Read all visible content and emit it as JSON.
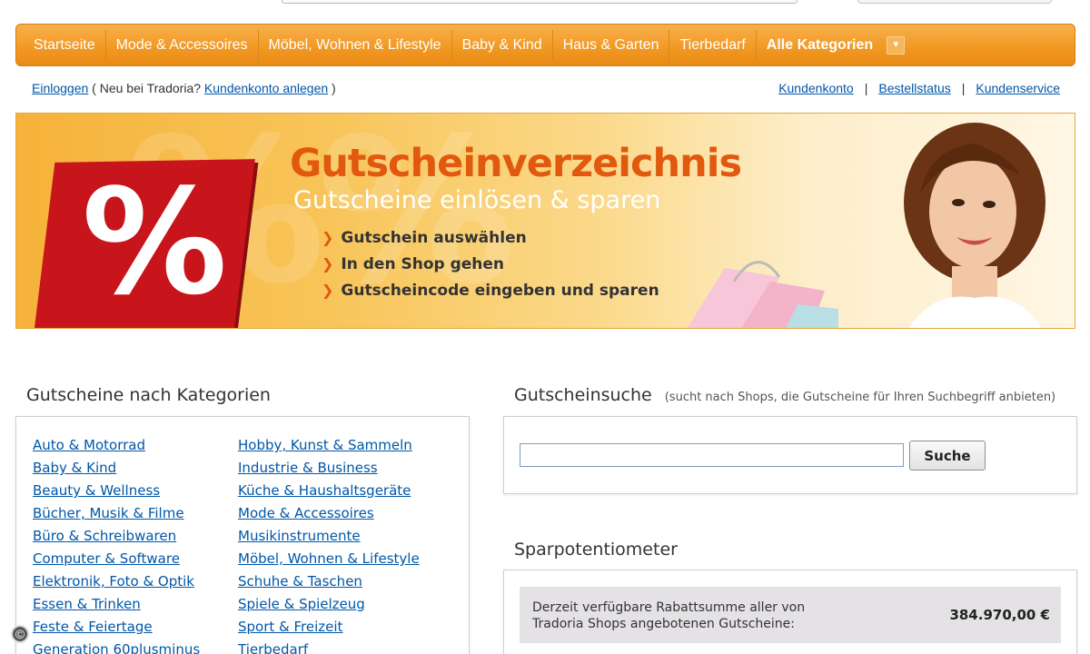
{
  "nav": {
    "items": [
      "Startseite",
      "Mode & Accessoires",
      "Möbel, Wohnen & Lifestyle",
      "Baby & Kind",
      "Haus & Garten",
      "Tierbedarf"
    ],
    "all": "Alle Kategorien"
  },
  "account": {
    "login": "Einloggen",
    "new_prefix": "( Neu bei Tradoria?",
    "create": "Kundenkonto anlegen",
    "close_paren": ")",
    "kundenkonto": "Kundenkonto",
    "bestellstatus": "Bestellstatus",
    "kundenservice": "Kundenservice",
    "sep": "|"
  },
  "banner": {
    "title": "Gutscheinverzeichnis",
    "subtitle": "Gutscheine einlösen & sparen",
    "steps": [
      "Gutschein auswählen",
      "In den Shop gehen",
      "Gutscheincode eingeben und sparen"
    ],
    "percent": "%"
  },
  "categories": {
    "title": "Gutscheine nach Kategorien",
    "col1": [
      "Auto & Motorrad",
      "Baby & Kind",
      "Beauty & Wellness",
      "Bücher, Musik & Filme",
      "Büro & Schreibwaren",
      "Computer & Software",
      "Elektronik, Foto & Optik",
      "Essen & Trinken",
      "Feste & Feiertage",
      "Generation 60plusminus"
    ],
    "col2": [
      "Hobby, Kunst & Sammeln",
      "Industrie & Business",
      "Küche & Haushaltsgeräte",
      "Mode & Accessoires",
      "Musikinstrumente",
      "Möbel, Wohnen & Lifestyle",
      "Schuhe & Taschen",
      "Spiele & Spielzeug",
      "Sport & Freizeit",
      "Tierbedarf"
    ]
  },
  "search": {
    "title": "Gutscheinsuche",
    "hint": "(sucht nach Shops, die Gutscheine für Ihren Suchbegriff anbieten)",
    "value": "",
    "button": "Suche"
  },
  "spar": {
    "title": "Sparpotentiometer",
    "text": "Derzeit verfügbare Rabattsumme aller von Tradoria Shops angebotenen Gutscheine:",
    "value": "384.970,00 €"
  },
  "copyright": "©"
}
